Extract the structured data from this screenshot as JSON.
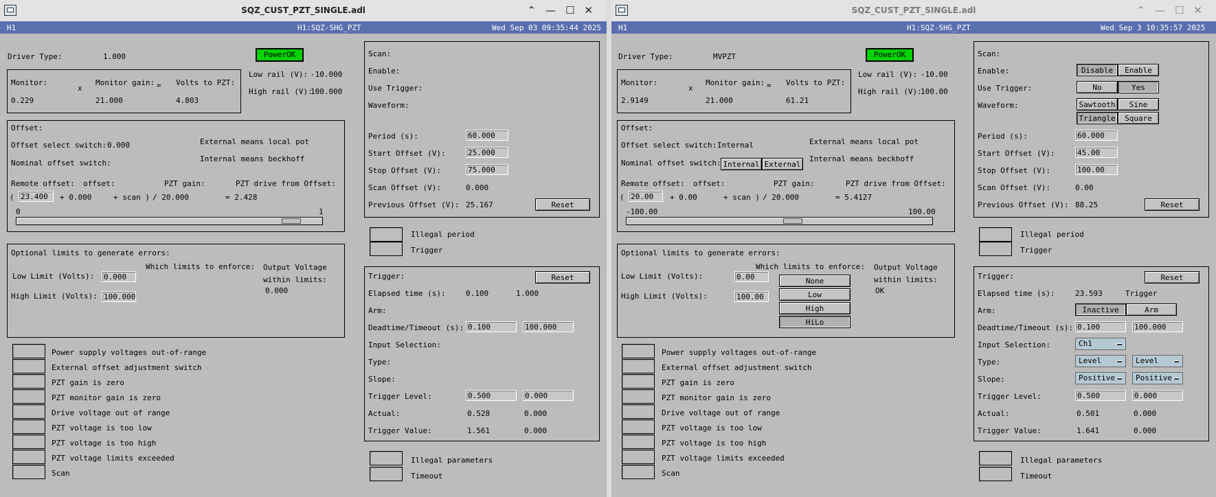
{
  "windows": [
    {
      "title": "SQZ_CUST_PZT_SINGLE.adl",
      "header": {
        "site": "H1",
        "device": "H1:SQZ-SHG_PZT",
        "datetime": "Wed Sep 03 09:35:44 2025"
      },
      "driver_type_label": "Driver Type:",
      "driver_type": "1.000",
      "power": "PowerOK",
      "monitor_label": "Monitor:",
      "monitor": "0.229",
      "times": "x",
      "monitor_gain_label": "Monitor gain:",
      "monitor_gain": "21.000",
      "equals": "=",
      "volts_label": "Volts to PZT:",
      "volts": "4.803",
      "low_rail_label": "Low rail (V):",
      "low_rail": "-10.000",
      "high_rail_label": "High rail (V):",
      "high_rail": "100.000",
      "offset_title": "Offset:",
      "offset_select_label": "Offset select switch:",
      "offset_select": "0.000",
      "ext_note": "External means local pot",
      "int_note": "Internal means beckhoff",
      "nominal_label": "Nominal offset switch:",
      "remote_label": "Remote offset:",
      "offset_label": "offset:",
      "pzt_gain_label": "PZT gain:",
      "drive_label": "PZT drive from Offset:",
      "paren_open": "(",
      "remote_offset": "23.400",
      "plus_offset": "+ 0.000",
      "plus_scan": "+ scan )",
      "div_gain": "/ 20.000",
      "drive_eq": "= 2.428",
      "slider_min": "0",
      "slider_max": "1",
      "slider_pos": 0.93,
      "limits_title": "Optional limits to generate errors:",
      "low_limit_label": "Low Limit (Volts):",
      "low_limit": "0.000",
      "high_limit_label": "High Limit (Volts):",
      "high_limit": "100.000",
      "which_label": "Which limits to enforce:",
      "output_label1": "Output Voltage",
      "output_label2": "within limits:",
      "output_value": "0.000",
      "indicators": [
        "Power supply voltages out-of-range",
        "External offset adjustment switch",
        "PZT gain is zero",
        "PZT monitor gain is zero",
        "Drive voltage out of range",
        "PZT voltage is too low",
        "PZT voltage is too high",
        "PZT voltage limits exceeded",
        "Scan"
      ],
      "scan": {
        "scan_label": "Scan:",
        "enable_label": "Enable:",
        "trigger_label": "Use Trigger:",
        "waveform_label": "Waveform:",
        "period_label": "Period (s):",
        "period": "60.000",
        "start_label": "Start Offset (V):",
        "start": "25.000",
        "stop_label": "Stop Offset (V):",
        "stop": "75.000",
        "scan_offset_label": "Scan Offset (V):",
        "scan_offset": "0.000",
        "prev_label": "Previous Offset (V):",
        "prev": "25.167",
        "reset": "Reset"
      },
      "illegal_period": "Illegal period",
      "trigger_ind": "Trigger",
      "trigger": {
        "title": "Trigger:",
        "reset": "Reset",
        "elapsed_label": "Elapsed time (s):",
        "elapsed": "0.100",
        "elapsed_state": "1.000",
        "arm_label": "Arm:",
        "deadtime_label": "Deadtime/Timeout (s):",
        "deadtime": "0.100",
        "timeout": "100.000",
        "input_label": "Input Selection:",
        "type_label": "Type:",
        "slope_label": "Slope:",
        "level_label": "Trigger Level:",
        "level": "0.500",
        "level2": "0.000",
        "actual_label": "Actual:",
        "actual": "0.528",
        "actual2": "0.000",
        "value_label": "Trigger Value:",
        "value": "1.561",
        "value2": "0.000"
      },
      "illegal_params": "Illegal parameters",
      "timeout_ind": "Timeout"
    },
    {
      "title": "SQZ_CUST_PZT_SINGLE.adl",
      "header": {
        "site": "H1",
        "device": "H1:SQZ-SHG_PZT",
        "datetime": "Wed Sep  3 10:35:57 2025"
      },
      "driver_type_label": "Driver Type:",
      "driver_type": "MVPZT",
      "power": "PowerOK",
      "monitor_label": "Monitor:",
      "monitor": "2.9149",
      "times": "x",
      "monitor_gain_label": "Monitor gain:",
      "monitor_gain": "21.000",
      "equals": "=",
      "volts_label": "Volts to PZT:",
      "volts": "61.21",
      "low_rail_label": "Low rail (V):",
      "low_rail": "-10.00",
      "high_rail_label": "High rail (V):",
      "high_rail": "100.00",
      "offset_title": "Offset:",
      "offset_select_label": "Offset select switch:",
      "offset_select": "Internal",
      "ext_note": "External means local pot",
      "int_note": "Internal means beckhoff",
      "nominal_label": "Nominal offset switch:",
      "nominal_opts": [
        "Internal",
        "External"
      ],
      "remote_label": "Remote offset:",
      "offset_label": "offset:",
      "pzt_gain_label": "PZT gain:",
      "drive_label": "PZT drive from Offset:",
      "paren_open": "(",
      "remote_offset": "20.00",
      "plus_offset": "+ 0.00",
      "plus_scan": "+ scan )",
      "div_gain": "/ 20.000",
      "drive_eq": "= 5.4127",
      "slider_min": "-100.00",
      "slider_max": "100.00",
      "slider_pos": 0.55,
      "limits_title": "Optional limits to generate errors:",
      "low_limit_label": "Low Limit (Volts):",
      "low_limit": "0.00",
      "high_limit_label": "High Limit (Volts):",
      "high_limit": "100.00",
      "which_label": "Which limits to enforce:",
      "which_opts": [
        "None",
        "Low",
        "High",
        "HiLo"
      ],
      "output_label1": "Output Voltage",
      "output_label2": "within limits:",
      "output_value": "OK",
      "indicators": [
        "Power supply voltages out-of-range",
        "External offset adjustment switch",
        "PZT gain is zero",
        "PZT monitor gain is zero",
        "Drive voltage out of range",
        "PZT voltage is too low",
        "PZT voltage is too high",
        "PZT voltage limits exceeded",
        "Scan"
      ],
      "scan": {
        "scan_label": "Scan:",
        "enable_label": "Enable:",
        "enable_opts": [
          "Disable",
          "Enable"
        ],
        "trigger_label": "Use Trigger:",
        "trigger_opts": [
          "No",
          "Yes"
        ],
        "waveform_label": "Waveform:",
        "waveform_opts": [
          "Sawtooth",
          "Sine",
          "Triangle",
          "Square"
        ],
        "period_label": "Period (s):",
        "period": "60.000",
        "start_label": "Start Offset (V):",
        "start": "45.00",
        "stop_label": "Stop Offset (V):",
        "stop": "100.00",
        "scan_offset_label": "Scan Offset (V):",
        "scan_offset": "0.00",
        "prev_label": "Previous Offset (V):",
        "prev": "88.25",
        "reset": "Reset"
      },
      "illegal_period": "Illegal period",
      "trigger_ind": "Trigger",
      "trigger": {
        "title": "Trigger:",
        "reset": "Reset",
        "elapsed_label": "Elapsed time (s):",
        "elapsed": "23.593",
        "elapsed_state": "Trigger",
        "arm_label": "Arm:",
        "arm_opts": [
          "Inactive",
          "Arm"
        ],
        "deadtime_label": "Deadtime/Timeout (s):",
        "deadtime": "0.100",
        "timeout": "100.000",
        "input_label": "Input Selection:",
        "input": "Ch1",
        "type_label": "Type:",
        "type1": "Level",
        "type2": "Level",
        "slope_label": "Slope:",
        "slope1": "Positive",
        "slope2": "Positive",
        "level_label": "Trigger Level:",
        "level": "0.500",
        "level2": "0.000",
        "actual_label": "Actual:",
        "actual": "0.501",
        "actual2": "0.000",
        "value_label": "Trigger Value:",
        "value": "1.641",
        "value2": "0.000"
      },
      "illegal_params": "Illegal parameters",
      "timeout_ind": "Timeout"
    }
  ]
}
